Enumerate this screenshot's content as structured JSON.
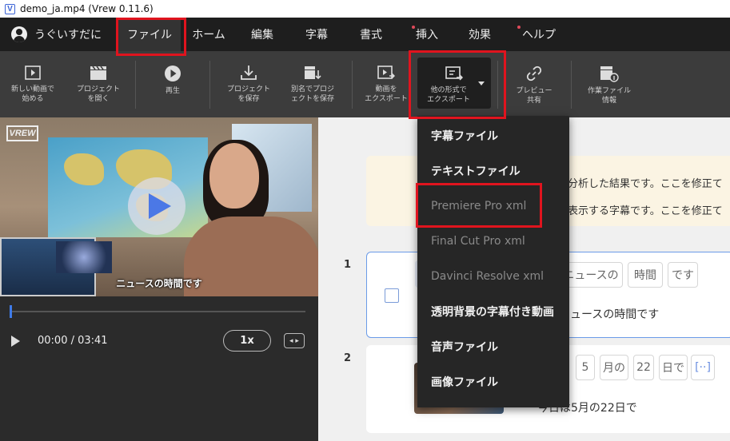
{
  "window": {
    "title": "demo_ja.mp4 (Vrew 0.11.6)",
    "app_icon_letter": "V"
  },
  "menubar": {
    "user_name": "うぐいすだに",
    "items": [
      {
        "label": "ファイル",
        "active": true
      },
      {
        "label": "ホーム"
      },
      {
        "label": "編集"
      },
      {
        "label": "字幕"
      },
      {
        "label": "書式"
      },
      {
        "label": "挿入",
        "dot": true
      },
      {
        "label": "効果"
      },
      {
        "label": "ヘルプ",
        "dot": true
      }
    ],
    "dot_color": "#e04a5a"
  },
  "toolbar": {
    "new_video": "新しい動画で\n始める",
    "open_project": "プロジェクト\nを開く",
    "play": "再生",
    "save_project": "プロジェクト\nを保存",
    "save_as": "別名でプロジ\nェクトを保存",
    "export_video": "動画を\nエクスポート",
    "export_other": "他の形式で\nエクスポート",
    "preview_share": "プレビュー\n共有",
    "project_info": "作業ファイル\n情報"
  },
  "export_menu": {
    "items": [
      {
        "label": "字幕ファイル",
        "enabled": true
      },
      {
        "label": "テキストファイル",
        "enabled": true
      },
      {
        "label": "Premiere Pro xml",
        "enabled": false
      },
      {
        "label": "Final Cut Pro xml",
        "enabled": false
      },
      {
        "label": "Davinci Resolve xml",
        "enabled": false
      },
      {
        "label": "透明背景の字幕付き動画",
        "enabled": true
      },
      {
        "label": "音声ファイル",
        "enabled": true
      },
      {
        "label": "画像ファイル",
        "enabled": true
      }
    ]
  },
  "player": {
    "logo": "VREW",
    "subtitle": "ニュースの時間です",
    "time": "00:00 / 03:41",
    "speed": "1x",
    "progress": 0.0
  },
  "notice": {
    "line1": "分析した結果です。ここを修正て",
    "line2": "表示する字幕です。ここを修正て"
  },
  "clips": [
    {
      "number": "1",
      "words": [
        "ニュースの",
        "時間",
        "です"
      ],
      "subtitle": "ニュースの時間です"
    },
    {
      "number": "2",
      "words": [
        "5",
        "月の",
        "22",
        "日で",
        "[··]"
      ],
      "subtitle": "今日は5月の22日で"
    }
  ],
  "colors": {
    "accent": "#3f7be8",
    "highlight": "#e0141e",
    "menubar_bg": "#1e1e1e",
    "toolbar_bg": "#3c3c3c"
  }
}
